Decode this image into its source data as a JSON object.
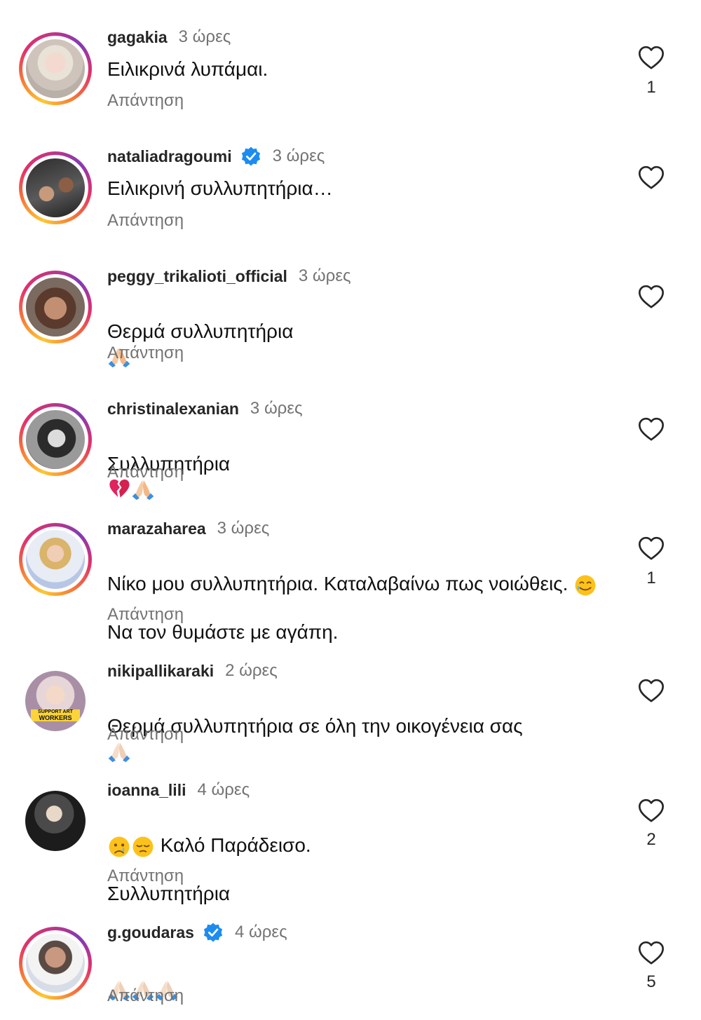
{
  "comments": [
    {
      "username": "gagakia",
      "time": "3 ώρες",
      "text": "Ειλικρινά λυπάμαι.",
      "reply": "Απάντηση",
      "likes": "1",
      "verified": false
    },
    {
      "username": "nataliadragoumi",
      "time": "3 ώρες",
      "text": "Ειλικρινή συλλυπητήρια…",
      "reply": "Απάντηση",
      "likes": "",
      "verified": true
    },
    {
      "username": "peggy_trikalioti_official",
      "time": "3 ώρες",
      "text": "Θερμά συλλυπητήρια",
      "reply": "Απάντηση",
      "likes": "",
      "verified": false
    },
    {
      "username": "christinalexanian",
      "time": "3 ώρες",
      "text": "Συλλυπητήρια",
      "reply": "Απάντηση",
      "likes": "",
      "verified": false
    },
    {
      "username": "marazaharea",
      "time": "3 ώρες",
      "text_line1": "Νίκο μου συλλυπητήρια. Καταλαβαίνω πως νοιώθεις.",
      "text_line2": "Να τον θυμάστε με αγάπη.",
      "reply": "Απάντηση",
      "likes": "1",
      "verified": false
    },
    {
      "username": "nikipallikaraki",
      "time": "2 ώρες",
      "text": "Θερμά συλλυπητήρια σε όλη την οικογένεια σας",
      "reply": "Απάντηση",
      "likes": "",
      "verified": false,
      "avatar_badge_line1": "SUPPORT ART",
      "avatar_badge_line2": "WORKERS"
    },
    {
      "username": "ioanna_lili",
      "time": "4 ώρες",
      "text_line1": "Καλό Παράδεισο.",
      "text_line2": "Συλλυπητήρια",
      "reply": "Απάντηση",
      "likes": "2",
      "verified": false
    },
    {
      "username": "g.goudaras",
      "time": "4 ώρες",
      "text": "",
      "reply": "Απάντηση",
      "likes": "5",
      "verified": true
    }
  ],
  "icons": {
    "like": "heart-outline-icon",
    "verified": "verified-badge-icon",
    "praying_hands": "folded-hands-emoji",
    "broken_heart": "broken-heart-emoji",
    "tear_smile": "smiling-face-with-tear-emoji",
    "crying": "crying-face-emoji",
    "pensive": "pensive-face-emoji"
  },
  "colors": {
    "verified": "#1d8cf0",
    "meta": "#737373",
    "text": "#111111"
  }
}
